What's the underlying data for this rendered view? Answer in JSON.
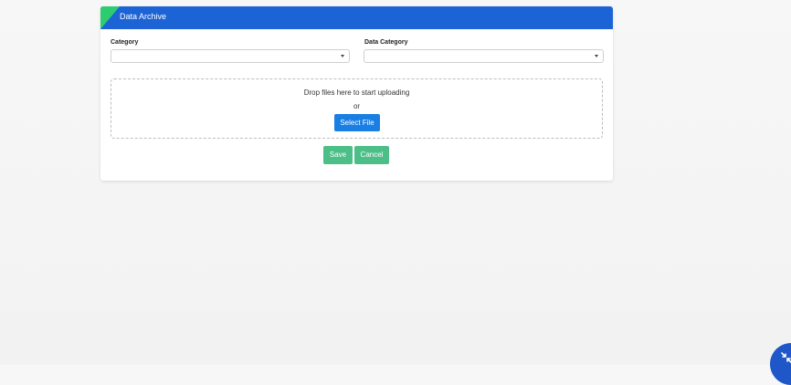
{
  "colors": {
    "header_bg": "#1c63d6",
    "corner_accent": "#2ecc71",
    "primary_button": "#1a7fe3",
    "success_button": "#4cbf88",
    "fab": "#1f57c8"
  },
  "card": {
    "title": "Data Archive"
  },
  "form": {
    "category_label": "Category",
    "category_value": "",
    "data_category_label": "Data Category",
    "data_category_value": ""
  },
  "dropzone": {
    "prompt": "Drop files here to start uploading",
    "or_text": "or",
    "select_button": "Select File"
  },
  "actions": {
    "save": "Save",
    "cancel": "Cancel"
  },
  "fab": {
    "icon": "compress-arrows-icon"
  }
}
